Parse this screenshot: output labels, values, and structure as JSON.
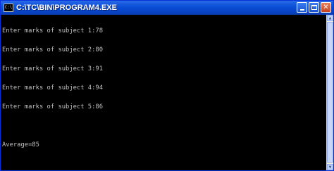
{
  "window": {
    "title": "C:\\TC\\BIN\\PROGRAM4.EXE",
    "icon_label": "C:\\"
  },
  "console": {
    "lines": [
      "Enter marks of subject 1:78",
      "Enter marks of subject 2:80",
      "Enter marks of subject 3:91",
      "Enter marks of subject 4:94",
      "Enter marks of subject 5:86",
      "",
      "Average=85"
    ]
  },
  "colors": {
    "console_bg": "#000000",
    "console_text": "#c0c0c0",
    "titlebar": "#0a4ed6"
  }
}
